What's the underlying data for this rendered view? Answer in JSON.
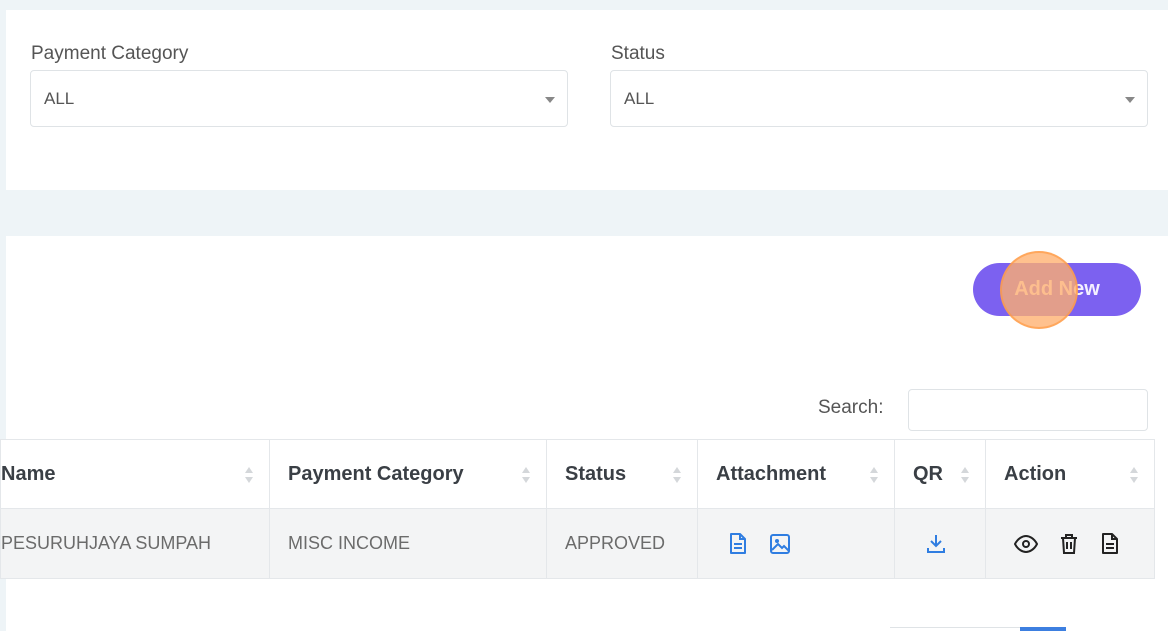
{
  "filters": {
    "payment_category": {
      "label": "Payment Category",
      "value": "ALL"
    },
    "status": {
      "label": "Status",
      "value": "ALL"
    }
  },
  "actions": {
    "add_new_label": "Add New"
  },
  "search": {
    "label": "Search:",
    "value": ""
  },
  "table": {
    "columns": [
      "Name",
      "Payment Category",
      "Status",
      "Attachment",
      "QR",
      "Action"
    ],
    "rows": [
      {
        "name": "PESURUHJAYA SUMPAH",
        "payment_category": "MISC INCOME",
        "status": "APPROVED",
        "attachment_icons": [
          "document-icon",
          "image-icon"
        ],
        "qr_icon": "download-icon",
        "action_icons": [
          "eye-icon",
          "trash-icon",
          "document-icon"
        ]
      }
    ]
  },
  "colors": {
    "primary_button": "#7c61f0",
    "link_icon_blue": "#2f7de1",
    "status_approved": "#2e8a3a",
    "page_background": "#eef4f7"
  }
}
